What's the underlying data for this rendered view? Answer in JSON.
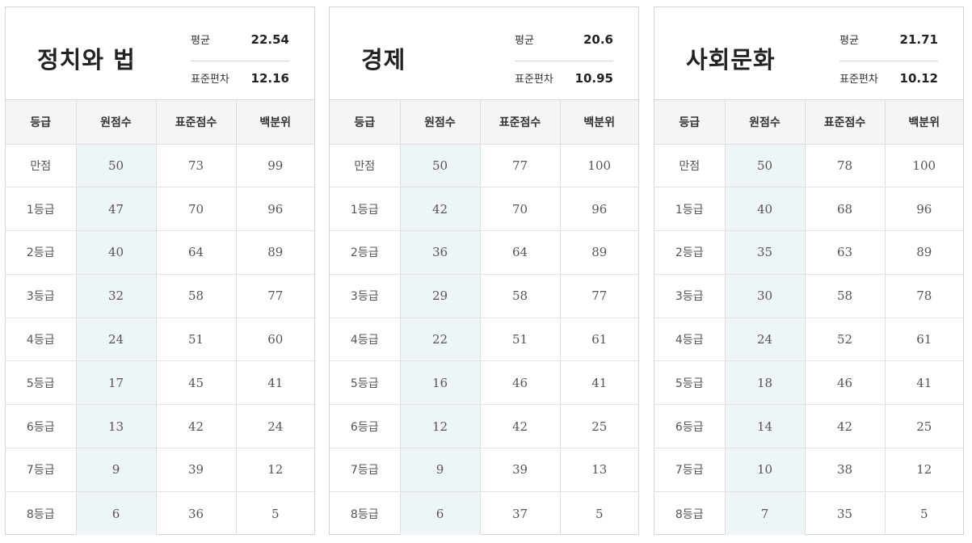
{
  "headers": [
    "등급",
    "원점수",
    "표준점수",
    "백분위"
  ],
  "labels": {
    "mean": "평균",
    "sd": "표준편차"
  },
  "panels": [
    {
      "subject": "정치와 법",
      "mean": "22.54",
      "sd": "12.16",
      "rows": [
        [
          "만점",
          "50",
          "73",
          "99"
        ],
        [
          "1등급",
          "47",
          "70",
          "96"
        ],
        [
          "2등급",
          "40",
          "64",
          "89"
        ],
        [
          "3등급",
          "32",
          "58",
          "77"
        ],
        [
          "4등급",
          "24",
          "51",
          "60"
        ],
        [
          "5등급",
          "17",
          "45",
          "41"
        ],
        [
          "6등급",
          "13",
          "42",
          "24"
        ],
        [
          "7등급",
          "9",
          "39",
          "12"
        ],
        [
          "8등급",
          "6",
          "36",
          "5"
        ]
      ]
    },
    {
      "subject": "경제",
      "mean": "20.6",
      "sd": "10.95",
      "rows": [
        [
          "만점",
          "50",
          "77",
          "100"
        ],
        [
          "1등급",
          "42",
          "70",
          "96"
        ],
        [
          "2등급",
          "36",
          "64",
          "89"
        ],
        [
          "3등급",
          "29",
          "58",
          "77"
        ],
        [
          "4등급",
          "22",
          "51",
          "61"
        ],
        [
          "5등급",
          "16",
          "46",
          "41"
        ],
        [
          "6등급",
          "12",
          "42",
          "25"
        ],
        [
          "7등급",
          "9",
          "39",
          "13"
        ],
        [
          "8등급",
          "6",
          "37",
          "5"
        ]
      ]
    },
    {
      "subject": "사회문화",
      "mean": "21.71",
      "sd": "10.12",
      "rows": [
        [
          "만점",
          "50",
          "78",
          "100"
        ],
        [
          "1등급",
          "40",
          "68",
          "96"
        ],
        [
          "2등급",
          "35",
          "63",
          "89"
        ],
        [
          "3등급",
          "30",
          "58",
          "78"
        ],
        [
          "4등급",
          "24",
          "52",
          "61"
        ],
        [
          "5등급",
          "18",
          "46",
          "41"
        ],
        [
          "6등급",
          "14",
          "42",
          "25"
        ],
        [
          "7등급",
          "10",
          "38",
          "12"
        ],
        [
          "8등급",
          "7",
          "35",
          "5"
        ]
      ]
    }
  ]
}
